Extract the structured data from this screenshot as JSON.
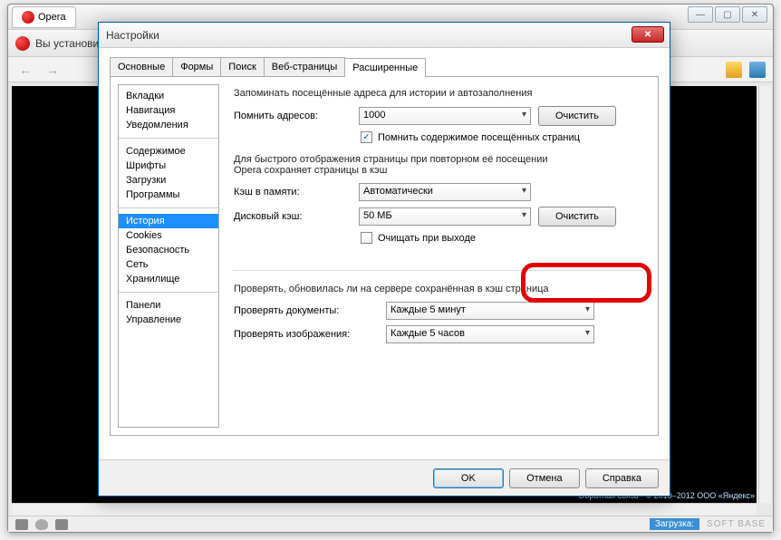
{
  "browser": {
    "tab_title": "Opera",
    "toolbar_text": "Вы установи",
    "nav_back": "←",
    "nav_fwd": "→"
  },
  "footer": {
    "feedback": "Обратная связь",
    "copyright": "© 2010–2012  ООО «Яндекс»"
  },
  "status": {
    "loading": "Загрузка:",
    "brand": "SOFT  BASE"
  },
  "dialog": {
    "title": "Настройки",
    "tabs": [
      "Основные",
      "Формы",
      "Поиск",
      "Веб-страницы",
      "Расширенные"
    ],
    "side": {
      "g1": [
        "Вкладки",
        "Навигация",
        "Уведомления"
      ],
      "g2": [
        "Содержимое",
        "Шрифты",
        "Загрузки",
        "Программы"
      ],
      "g3": [
        "История",
        "Cookies",
        "Безопасность",
        "Сеть",
        "Хранилище"
      ],
      "g4": [
        "Панели",
        "Управление"
      ]
    },
    "pane": {
      "intro": "Запоминать посещённые адреса для истории и автозаполнения",
      "remember_label": "Помнить адресов:",
      "remember_value": "1000",
      "clear_btn": "Очистить",
      "remember_content": "Помнить содержимое посещённых страниц",
      "cache_intro1": "Для быстрого отображения страницы при повторном её посещении",
      "cache_intro2": "Opera сохраняет страницы в кэш",
      "mem_cache_label": "Кэш в памяти:",
      "mem_cache_value": "Автоматически",
      "disk_cache_label": "Дисковый кэш:",
      "disk_cache_value": "50 МБ",
      "clear_exit": "Очищать при выходе",
      "check_intro": "Проверять, обновилась ли на сервере сохранённая в кэш страница",
      "check_docs_label": "Проверять документы:",
      "check_docs_value": "Каждые 5 минут",
      "check_imgs_label": "Проверять изображения:",
      "check_imgs_value": "Каждые 5 часов"
    },
    "buttons": {
      "ok": "OK",
      "cancel": "Отмена",
      "help": "Справка"
    }
  }
}
